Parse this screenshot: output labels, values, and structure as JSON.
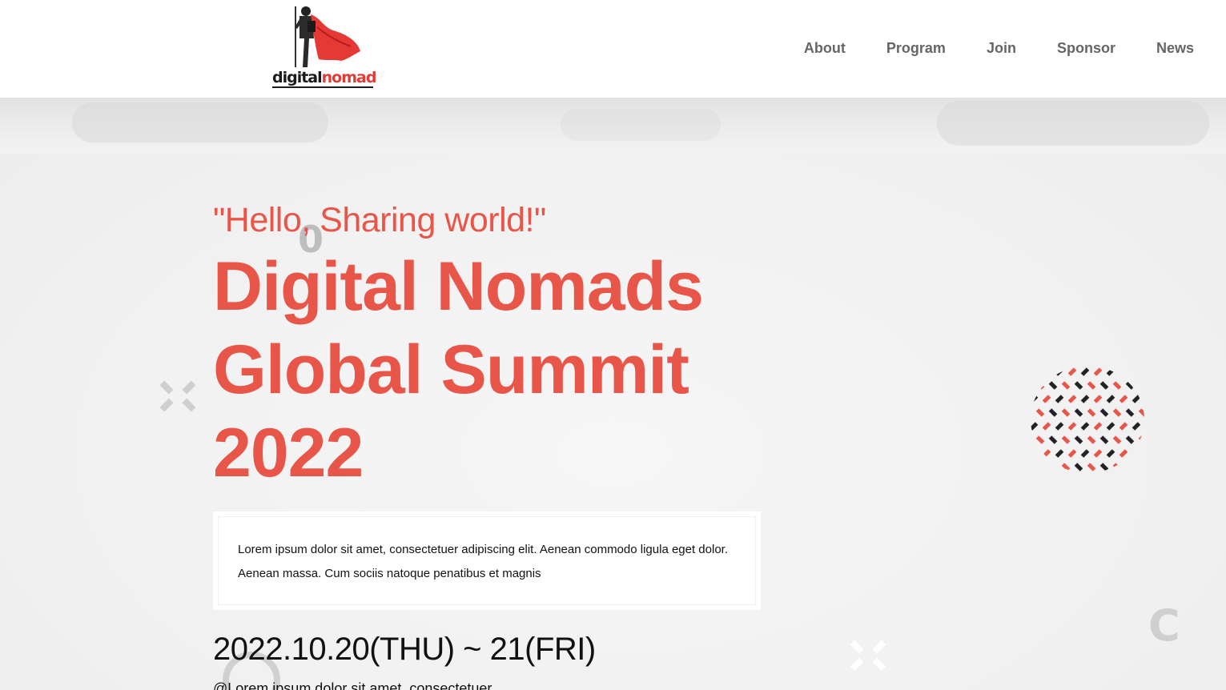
{
  "brand": {
    "logo_dark": "digital",
    "logo_red": "nomad"
  },
  "nav": {
    "items": [
      "About",
      "Program",
      "Join",
      "Sponsor",
      "News"
    ]
  },
  "hero": {
    "tagline": "\"Hello, Sharing world!\"",
    "title_line1": "Digital Nomads",
    "title_line2": "Global Summit",
    "title_line3": "2022",
    "description_line1": "Lorem ipsum dolor sit amet, consectetuer adipiscing elit. Aenean commodo ligula eget dolor.",
    "description_line2": "Aenean massa. Cum sociis natoque penatibus et magnis",
    "date": "2022.10.20(THU) ~ 21(FRI)",
    "venue": "@Lorem ipsum dolor sit amet, consectetuer"
  },
  "colors": {
    "accent": "#e8564a",
    "nav_text": "#666666",
    "text": "#111111",
    "background": "#f3f3f3"
  },
  "icons": [
    "cross-shape-icon",
    "pattern-circle-icon",
    "letter-c-icon",
    "zero-icon"
  ]
}
